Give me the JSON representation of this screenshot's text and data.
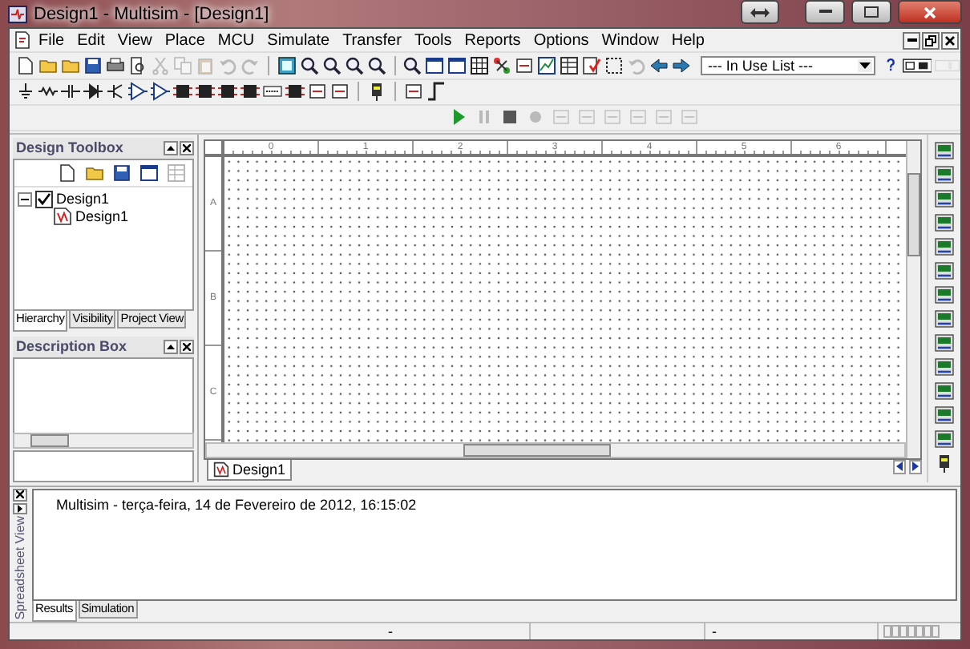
{
  "window": {
    "title": "Design1 - Multisim - [Design1]"
  },
  "menu": [
    "File",
    "Edit",
    "View",
    "Place",
    "MCU",
    "Simulate",
    "Transfer",
    "Tools",
    "Reports",
    "Options",
    "Window",
    "Help"
  ],
  "standard_toolbar": [
    [
      {
        "disabled": false
      },
      {
        "disabled": false
      },
      {
        "disabled": false
      },
      {
        "disabled": false
      },
      {
        "disabled": false
      },
      {
        "disabled": false
      },
      {
        "disabled": true
      },
      {
        "disabled": true
      },
      {
        "disabled": true
      },
      {
        "disabled": true
      },
      {
        "disabled": true
      }
    ],
    [
      {
        "disabled": false
      },
      {
        "disabled": false
      },
      {
        "disabled": false
      },
      {
        "disabled": false
      },
      {
        "disabled": false
      }
    ],
    [
      {
        "disabled": false
      },
      {
        "disabled": false
      },
      {
        "disabled": false
      },
      {
        "disabled": false
      },
      {
        "disabled": false
      },
      {
        "disabled": false
      },
      {
        "disabled": false
      },
      {
        "disabled": false
      },
      {
        "disabled": false
      },
      {
        "disabled": false
      },
      {
        "disabled": true
      },
      {
        "disabled": false
      },
      {
        "disabled": false
      }
    ]
  ],
  "in_use_list": {
    "value": "--- In Use List ---"
  },
  "component_toolbar": [
    [
      {
        "disabled": false
      },
      {
        "disabled": false
      },
      {
        "disabled": false
      },
      {
        "disabled": false
      },
      {
        "disabled": false
      },
      {
        "disabled": false
      },
      {
        "disabled": false
      },
      {
        "disabled": false
      },
      {
        "disabled": false
      },
      {
        "disabled": false
      },
      {
        "disabled": false
      },
      {
        "disabled": false
      },
      {
        "disabled": false
      },
      {
        "disabled": false
      },
      {
        "disabled": false
      }
    ],
    [
      {
        "disabled": false
      }
    ],
    [
      {
        "disabled": false
      },
      {
        "disabled": false
      }
    ]
  ],
  "simulation_toolbar": [
    {
      "disabled": false
    },
    {
      "disabled": true
    },
    {
      "disabled": false
    },
    {
      "disabled": true
    },
    {
      "disabled": true
    },
    {
      "disabled": true
    },
    {
      "disabled": true
    },
    {
      "disabled": true
    },
    {
      "disabled": true
    },
    {
      "disabled": true
    }
  ],
  "design_toolbox": {
    "title": "Design Toolbox",
    "tree": [
      {
        "label": "Design1",
        "checked": true,
        "expanded": true,
        "children": [
          {
            "label": "Design1"
          }
        ]
      }
    ],
    "tabs": [
      {
        "label": "Hierarchy",
        "selected": true
      },
      {
        "label": "Visibility",
        "selected": false
      },
      {
        "label": "Project View",
        "selected": false
      }
    ]
  },
  "description_box": {
    "title": "Description Box"
  },
  "schematic": {
    "column_labels": [
      "0",
      "1",
      "2",
      "3",
      "4",
      "5",
      "6"
    ],
    "row_labels": [
      "A",
      "B",
      "C"
    ],
    "tabs": [
      {
        "label": "Design1",
        "selected": true
      }
    ]
  },
  "spreadsheet_view": {
    "title": "Spreadsheet View",
    "message": "Multisim  -  terça-feira, 14 de Fevereiro de 2012, 16:15:02",
    "tabs": [
      {
        "label": "Results",
        "selected": true
      },
      {
        "label": "Simulation",
        "selected": false
      }
    ]
  },
  "status_bar": [
    "-",
    "-"
  ]
}
